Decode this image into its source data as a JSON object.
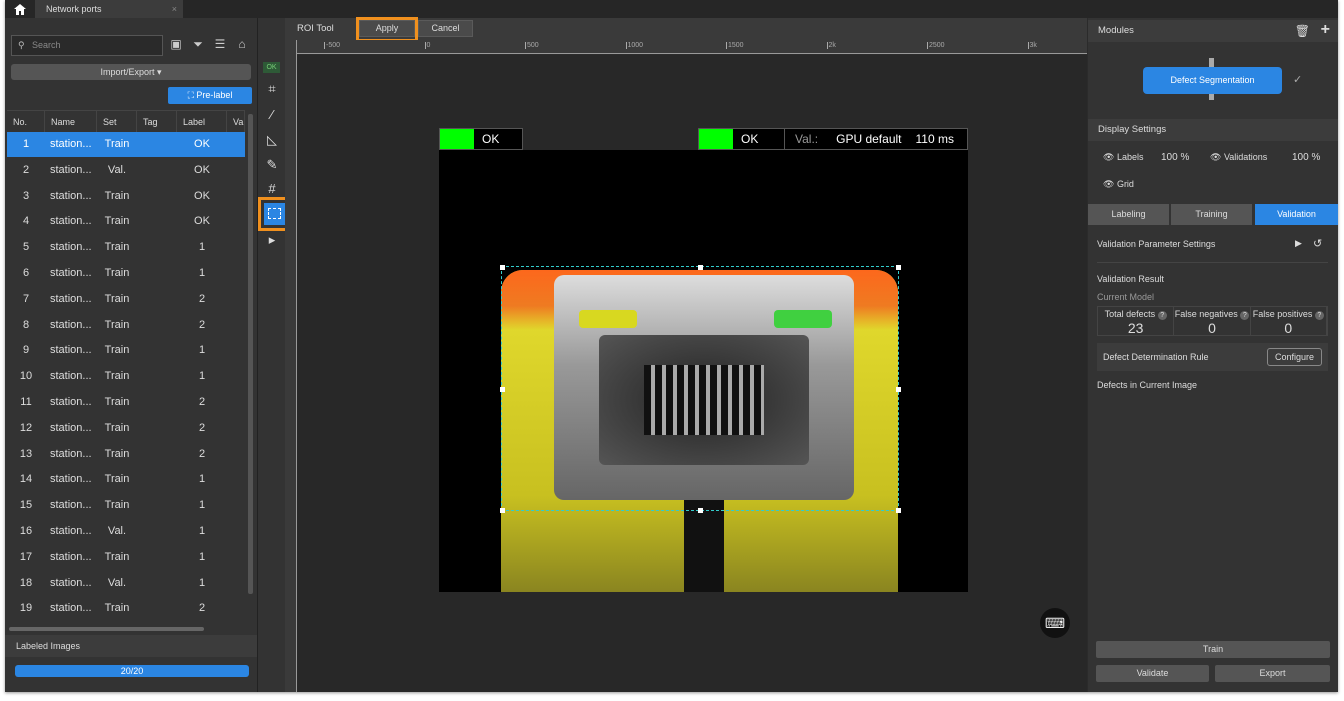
{
  "tab": {
    "title": "Network ports",
    "close": "×"
  },
  "left": {
    "search_placeholder": "Search",
    "import_export": "Import/Export ▾",
    "prelabel": "Pre-label",
    "columns": [
      "No.",
      "Name",
      "Set",
      "Tag",
      "Label",
      "Va"
    ],
    "rows": [
      [
        "1",
        "station...",
        "Train",
        "",
        "OK"
      ],
      [
        "2",
        "station...",
        "Val.",
        "",
        "OK"
      ],
      [
        "3",
        "station...",
        "Train",
        "",
        "OK"
      ],
      [
        "4",
        "station...",
        "Train",
        "",
        "OK"
      ],
      [
        "5",
        "station...",
        "Train",
        "",
        "1"
      ],
      [
        "6",
        "station...",
        "Train",
        "",
        "1"
      ],
      [
        "7",
        "station...",
        "Train",
        "",
        "2"
      ],
      [
        "8",
        "station...",
        "Train",
        "",
        "2"
      ],
      [
        "9",
        "station...",
        "Train",
        "",
        "1"
      ],
      [
        "10",
        "station...",
        "Train",
        "",
        "1"
      ],
      [
        "11",
        "station...",
        "Train",
        "",
        "2"
      ],
      [
        "12",
        "station...",
        "Train",
        "",
        "2"
      ],
      [
        "13",
        "station...",
        "Train",
        "",
        "2"
      ],
      [
        "14",
        "station...",
        "Train",
        "",
        "1"
      ],
      [
        "15",
        "station...",
        "Train",
        "",
        "1"
      ],
      [
        "16",
        "station...",
        "Val.",
        "",
        "1"
      ],
      [
        "17",
        "station...",
        "Train",
        "",
        "1"
      ],
      [
        "18",
        "station...",
        "Val.",
        "",
        "1"
      ],
      [
        "19",
        "station...",
        "Train",
        "",
        "2"
      ]
    ],
    "selected_row": 1,
    "labeled_images": "Labeled Images",
    "progress_text": "20/20",
    "progress_fraction": 1.0
  },
  "tools": {
    "ok_badge": "OK"
  },
  "roi": {
    "title": "ROI Tool",
    "apply": "Apply",
    "cancel": "Cancel"
  },
  "ruler": {
    "h": [
      "-500",
      "0",
      "500",
      "1000",
      "1500",
      "2k",
      "2500",
      "3k"
    ]
  },
  "image": {
    "label_left": "OK",
    "label_right": "OK",
    "val_label": "Val.:",
    "gpu": "GPU default",
    "time": "110 ms",
    "ok_color": "#00ff00"
  },
  "right": {
    "modules": "Modules",
    "module_name": "Defect Segmentation",
    "display_settings": "Display Settings",
    "labels": "Labels",
    "labels_pct": "100 %",
    "validations": "Validations",
    "validations_pct": "100 %",
    "grid": "Grid",
    "tabs": [
      "Labeling",
      "Training",
      "Validation"
    ],
    "active_tab": "Validation",
    "vps": "Validation Parameter Settings",
    "result": "Validation Result",
    "current_model": "Current Model",
    "stats": [
      {
        "label": "Total defects",
        "value": "23"
      },
      {
        "label": "False negatives",
        "value": "0"
      },
      {
        "label": "False positives",
        "value": "0"
      }
    ],
    "rule": "Defect Determination Rule",
    "configure": "Configure",
    "defects_current": "Defects in Current Image",
    "train": "Train",
    "validate": "Validate",
    "export": "Export"
  },
  "colors": {
    "accent": "#2b86e3",
    "highlight": "#f0901e"
  }
}
